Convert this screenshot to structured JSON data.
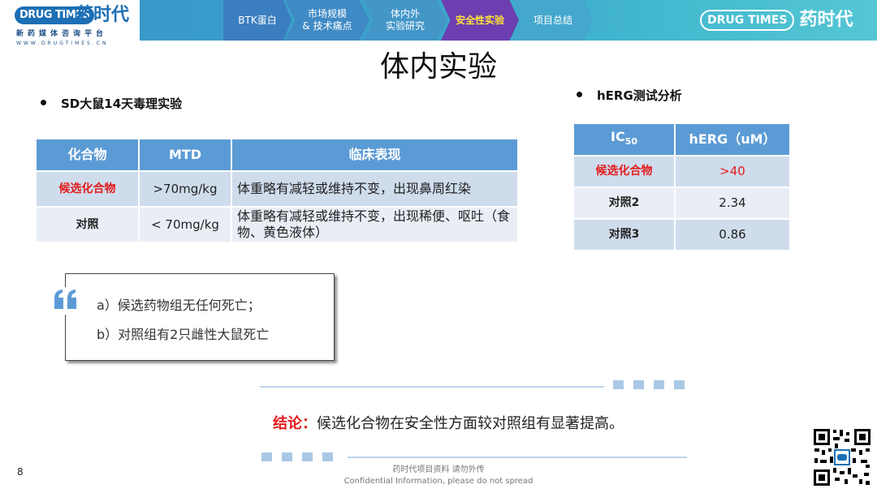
{
  "brand": {
    "logo_left_en": "DRUG TIMES",
    "logo_left_cn": "药时代",
    "tagline": "新药媒体咨询平台",
    "url": "WWW.DRUGTIMES.CN",
    "logo_right_en": "DRUG TIMES",
    "logo_right_cn": "药时代"
  },
  "nav": {
    "items": [
      {
        "label": "BTK蛋白"
      },
      {
        "label": "市场规模\n& 技术痛点"
      },
      {
        "label": "体内外\n实验研究"
      },
      {
        "label": "安全性实验"
      },
      {
        "label": "项目总结"
      }
    ],
    "active_index": 3,
    "active_color": "#ffe33a"
  },
  "page": {
    "title": "体内实验",
    "number": "8"
  },
  "toxicity": {
    "heading": "SD大鼠14天毒理实验",
    "headers": [
      "化合物",
      "MTD",
      "临床表现"
    ],
    "rows": [
      {
        "compound": "候选化合物",
        "mtd": ">70mg/kg",
        "clinical": "体重略有减轻或维持不变，出现鼻周红染"
      },
      {
        "compound": "对照",
        "mtd": "< 70mg/kg",
        "clinical": "体重略有减轻或维持不变，出现稀便、呕吐（食物、黄色液体）"
      }
    ]
  },
  "herg": {
    "heading": "hERG测试分析",
    "header_ic": "IC",
    "header_ic_sub": "50",
    "header_value": "hERG（uM）",
    "rows": [
      {
        "compound": "候选化合物",
        "value": ">40"
      },
      {
        "compound": "对照2",
        "value": "2.34"
      },
      {
        "compound": "对照3",
        "value": "0.86"
      }
    ]
  },
  "findings": [
    "a）候选药物组无任何死亡；",
    "b）对照组有2只雌性大鼠死亡"
  ],
  "conclusion": {
    "label": "结论：",
    "text": "候选化合物在安全性方面较对照组有显著提高。"
  },
  "footer": {
    "line1": "药时代项目资料 请勿外传",
    "line2": "Confidential Information, please do not spread"
  },
  "colors": {
    "highlight_red": "#e31b1b",
    "table_header": "#5b9bd5"
  }
}
